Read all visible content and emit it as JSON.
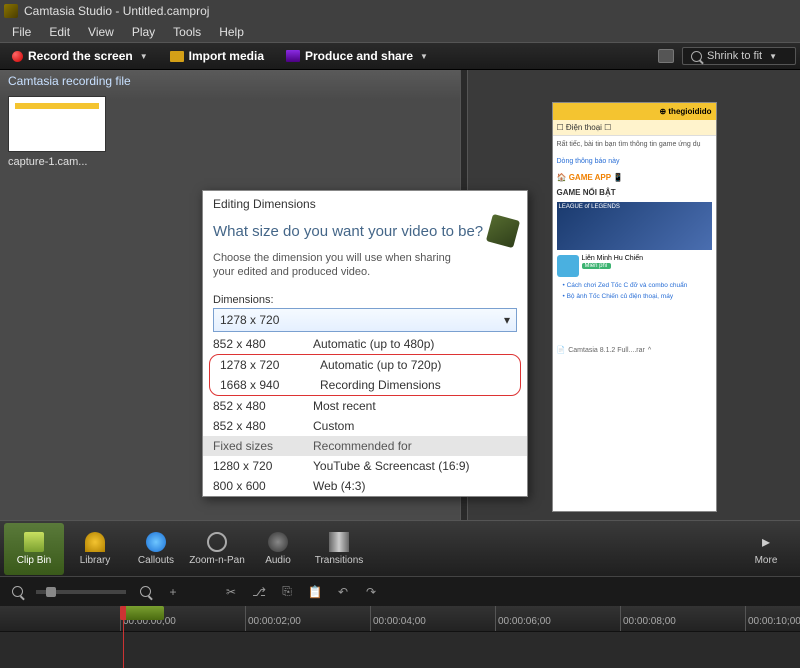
{
  "title": "Camtasia Studio - Untitled.camproj",
  "menu": [
    "File",
    "Edit",
    "View",
    "Play",
    "Tools",
    "Help"
  ],
  "toolbar": {
    "record": "Record the screen",
    "import": "Import media",
    "produce": "Produce and share",
    "shrink": "Shrink to fit"
  },
  "panel": {
    "heading": "Camtasia recording file",
    "thumb": "capture-1.cam..."
  },
  "tabs": [
    "Clip Bin",
    "Library",
    "Callouts",
    "Zoom-n-Pan",
    "Audio",
    "Transitions",
    "More"
  ],
  "timecodes": [
    "00:00:00;00",
    "00:00:02;00",
    "00:00:04;00",
    "00:00:06;00",
    "00:00:08;00",
    "00:00:10;00"
  ],
  "dialog": {
    "title": "Editing Dimensions",
    "question": "What size do you want your video to be?",
    "sub": "Choose the dimension you will use when sharing your edited and produced video.",
    "dim_label": "Dimensions:",
    "selected": "1278 x 720",
    "rows": [
      {
        "a": "852 x 480",
        "b": "Automatic (up to 480p)"
      },
      {
        "a": "1278 x 720",
        "b": "Automatic (up to 720p)"
      },
      {
        "a": "1668 x 940",
        "b": "Recording Dimensions"
      },
      {
        "a": "852 x 480",
        "b": "Most recent"
      },
      {
        "a": "852 x 480",
        "b": "Custom"
      }
    ],
    "header": {
      "a": "Fixed sizes",
      "b": "Recommended for"
    },
    "rows2": [
      {
        "a": "1280 x 720",
        "b": "YouTube & Screencast (16:9)"
      },
      {
        "a": "800 x 600",
        "b": "Web (4:3)"
      }
    ]
  },
  "preview": {
    "brand": "⊕ thegioidido",
    "tab": "☐ Điện thoại   ☐",
    "body1": "Rất tiếc, bài tin bạn tìm thông tin game ứng dụ",
    "link": "Dòng thông báo này",
    "sec1": "GAME APP",
    "sec2": "GAME NỔI BẬT",
    "gamelabel": "LEAGUE of LEGENDS",
    "item": "Liên Minh Hu Chiến",
    "free": "Miễn phí",
    "b1": "Cách chơi Zed Tốc C đỡ và combo chuẩn",
    "b2": "Bộ ảnh Tốc Chiến củ điện thoại, máy",
    "caption": "Camtasia 8.1.2 Full....rar"
  }
}
